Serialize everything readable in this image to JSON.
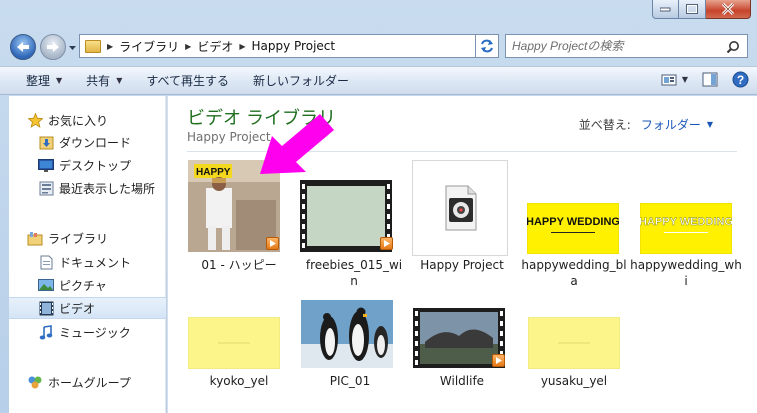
{
  "window": {
    "address": {
      "crumbs": [
        "ライブラリ",
        "ビデオ",
        "Happy Project"
      ]
    },
    "search": {
      "placeholder": "Happy Projectの検索"
    }
  },
  "toolbar": {
    "organize": "整理",
    "share": "共有",
    "play_all": "すべて再生する",
    "new_folder": "新しいフォルダー"
  },
  "sidebar": {
    "favorites": "お気に入り",
    "downloads": "ダウンロード",
    "desktop": "デスクトップ",
    "recent": "最近表示した場所",
    "libraries": "ライブラリ",
    "documents": "ドキュメント",
    "pictures": "ピクチャ",
    "videos": "ビデオ",
    "music": "ミュージック",
    "homegroup": "ホームグループ"
  },
  "main": {
    "title": "ビデオ ライブラリ",
    "subtitle": "Happy Project",
    "sort_label": "並べ替え:",
    "sort_value": "フォルダー",
    "files": [
      {
        "name": "01 - ハッピー",
        "kind": "video",
        "thumb_text": "HAPPY"
      },
      {
        "name": "freebies_015_win",
        "kind": "video"
      },
      {
        "name": "Happy Project",
        "kind": "project"
      },
      {
        "name": "happywedding_bla",
        "kind": "image",
        "thumb_text": "HAPPY WEDDING"
      },
      {
        "name": "happywedding_whi",
        "kind": "image",
        "thumb_text": "HAPPY WEDDING"
      },
      {
        "name": "kyoko_yel",
        "kind": "image"
      },
      {
        "name": "PIC_01",
        "kind": "image"
      },
      {
        "name": "Wildlife",
        "kind": "video"
      },
      {
        "name": "yusaku_yel",
        "kind": "image"
      }
    ]
  },
  "colors": {
    "library_title": "#1f6f1f",
    "link_blue": "#1a56b6",
    "annotation_arrow": "#ff00ee",
    "yellow_thumb": "#fff100",
    "pale_yellow_thumb": "#fbf58a"
  }
}
